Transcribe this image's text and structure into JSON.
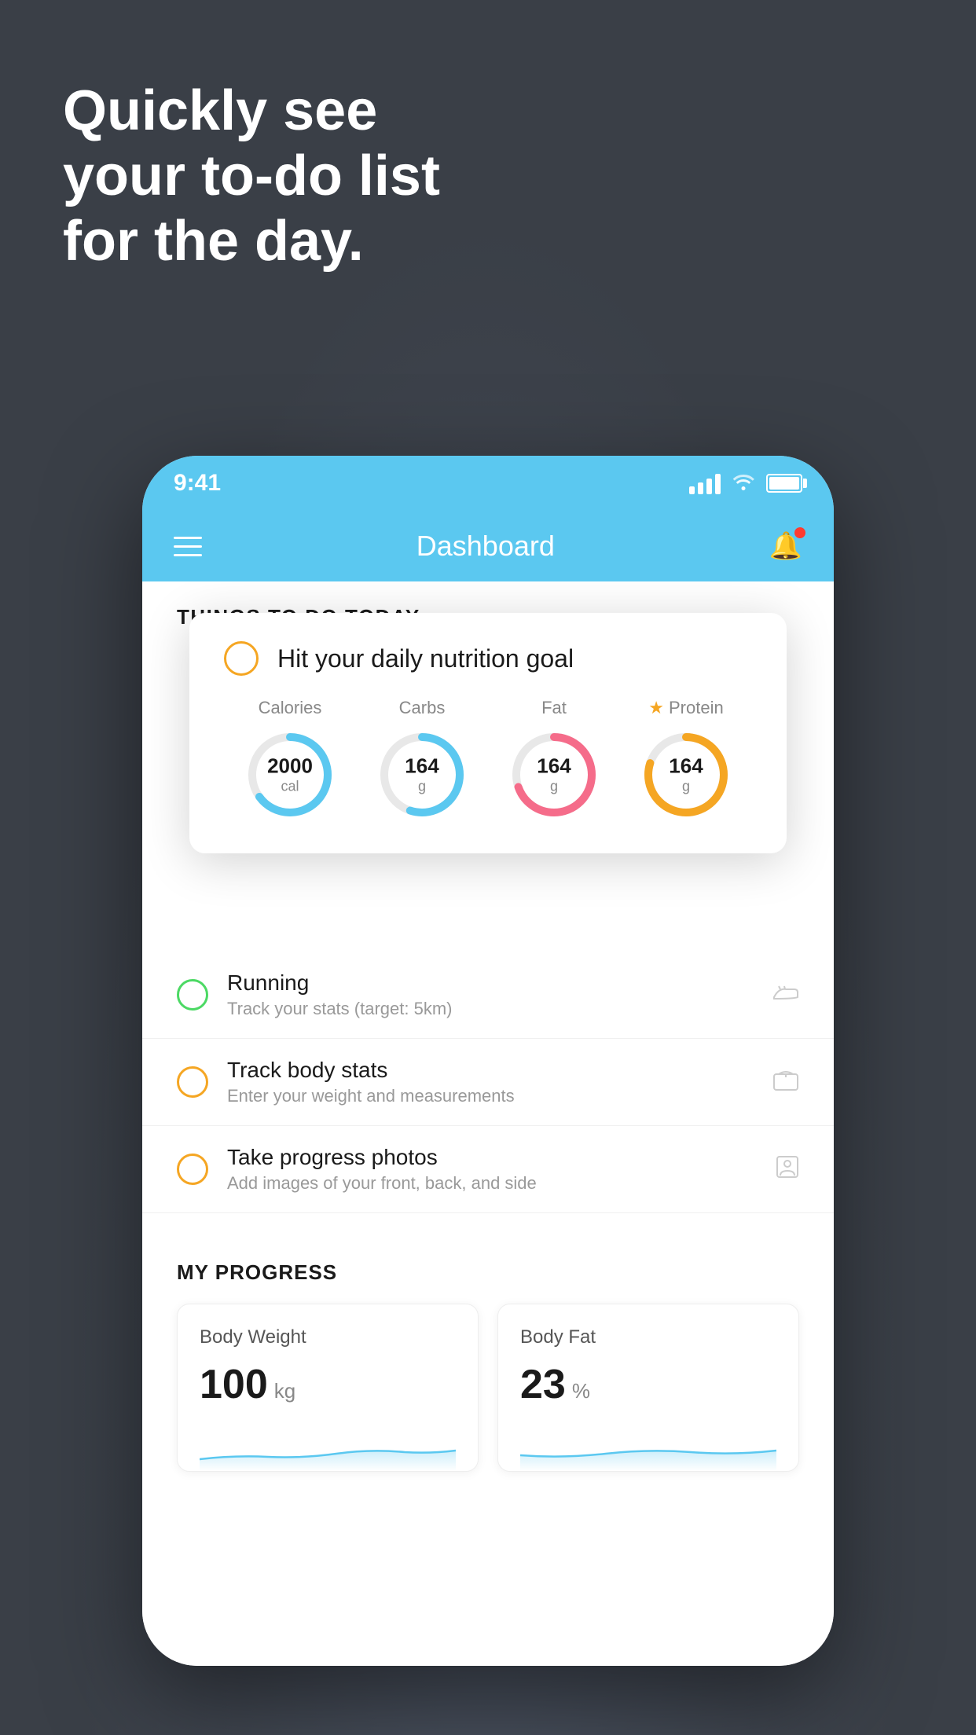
{
  "background_color": "#3a3f47",
  "headline": {
    "line1": "Quickly see",
    "line2": "your to-do list",
    "line3": "for the day."
  },
  "phone": {
    "status_bar": {
      "time": "9:41",
      "signal_bars": 4,
      "wifi": true,
      "battery": 85
    },
    "nav": {
      "title": "Dashboard"
    },
    "things_section_label": "THINGS TO DO TODAY",
    "floating_card": {
      "title": "Hit your daily nutrition goal",
      "nutrients": [
        {
          "label": "Calories",
          "value": "2000",
          "unit": "cal",
          "color": "#5bc8f0",
          "percent": 65,
          "starred": false
        },
        {
          "label": "Carbs",
          "value": "164",
          "unit": "g",
          "color": "#5bc8f0",
          "percent": 55,
          "starred": false
        },
        {
          "label": "Fat",
          "value": "164",
          "unit": "g",
          "color": "#f56c8a",
          "percent": 70,
          "starred": false
        },
        {
          "label": "Protein",
          "value": "164",
          "unit": "g",
          "color": "#f5a623",
          "percent": 80,
          "starred": true
        }
      ]
    },
    "todo_items": [
      {
        "title": "Running",
        "subtitle": "Track your stats (target: 5km)",
        "circle": "green",
        "icon": "shoe"
      },
      {
        "title": "Track body stats",
        "subtitle": "Enter your weight and measurements",
        "circle": "yellow",
        "icon": "scale"
      },
      {
        "title": "Take progress photos",
        "subtitle": "Add images of your front, back, and side",
        "circle": "yellow",
        "icon": "person"
      }
    ],
    "progress_section": {
      "title": "MY PROGRESS",
      "cards": [
        {
          "title": "Body Weight",
          "value": "100",
          "unit": "kg"
        },
        {
          "title": "Body Fat",
          "value": "23",
          "unit": "%"
        }
      ]
    }
  }
}
